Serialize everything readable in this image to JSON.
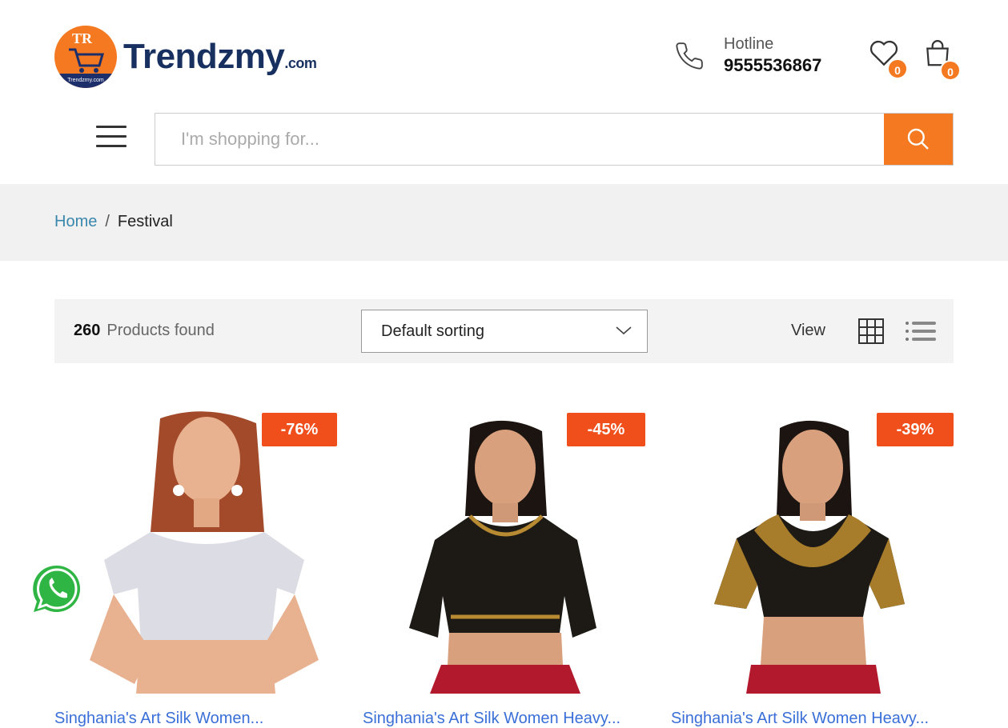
{
  "brand": {
    "name": "Trendzmy",
    "suffix": ".com",
    "badge_letters": "TR",
    "badge_caption": "Trendzmy.com"
  },
  "header": {
    "hotline_label": "Hotline",
    "hotline_number": "9555536867",
    "wishlist_count": "0",
    "cart_count": "0",
    "accent_color": "#f47920"
  },
  "search": {
    "placeholder": "I'm shopping for..."
  },
  "breadcrumb": {
    "home": "Home",
    "separator": "/",
    "current": "Festival"
  },
  "toolbar": {
    "count": "260",
    "count_label": "Products found",
    "sort_selected": "Default sorting",
    "view_label": "View"
  },
  "products": [
    {
      "discount": "-76%",
      "title": "Singhania's Art Silk Women..."
    },
    {
      "discount": "-45%",
      "title": "Singhania's Art Silk Women Heavy..."
    },
    {
      "discount": "-39%",
      "title": "Singhania's Art Silk Women Heavy..."
    }
  ],
  "icons": [
    "phone-icon",
    "wishlist-heart-icon",
    "cart-bag-icon",
    "hamburger-menu-icon",
    "search-icon",
    "chevron-down-icon",
    "grid-view-icon",
    "list-view-icon",
    "whatsapp-icon"
  ]
}
